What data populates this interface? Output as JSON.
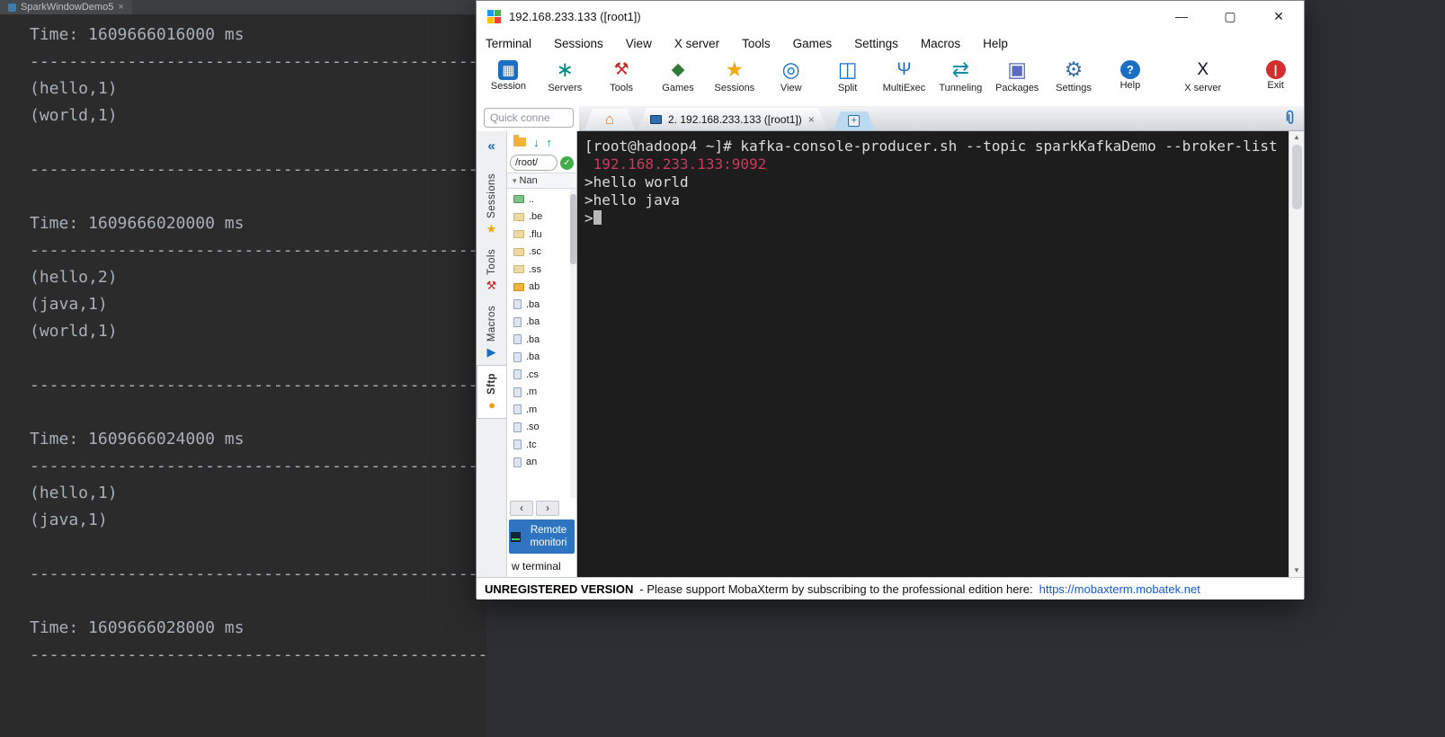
{
  "ide": {
    "tab": {
      "title": "SparkWindowDemo5",
      "close": "×"
    },
    "console_lines": [
      "Time: 1609666016000 ms",
      "-----------------------------------------------",
      "(hello,1)",
      "(world,1)",
      "",
      "-----------------------------------------------",
      "",
      "Time: 1609666020000 ms",
      "-----------------------------------------------",
      "(hello,2)",
      "(java,1)",
      "(world,1)",
      "",
      "-----------------------------------------------",
      "",
      "Time: 1609666024000 ms",
      "-----------------------------------------------",
      "(hello,1)",
      "(java,1)",
      "",
      "-----------------------------------------------",
      "",
      "Time: 1609666028000 ms",
      "-----------------------------------------------"
    ]
  },
  "moba": {
    "title": "192.168.233.133 ([root1])",
    "window_controls": {
      "minimize": "—",
      "maximize": "▢",
      "close": "✕"
    },
    "menu": [
      "Terminal",
      "Sessions",
      "View",
      "X server",
      "Tools",
      "Games",
      "Settings",
      "Macros",
      "Help"
    ],
    "toolbar": [
      {
        "label": "Session",
        "icon": "session-icon",
        "glyph": "▦",
        "color": "#ffffff",
        "bg": "#1a6fc4",
        "cls": "sq"
      },
      {
        "label": "Servers",
        "icon": "servers-icon",
        "glyph": "∗",
        "color": "#00897b",
        "cls": "big"
      },
      {
        "label": "Tools",
        "icon": "tools-icon",
        "glyph": "⚒",
        "color": "#c62828"
      },
      {
        "label": "Games",
        "icon": "games-icon",
        "glyph": "◆",
        "color": "#2e7d32"
      },
      {
        "label": "Sessions",
        "icon": "sessions-star-icon",
        "glyph": "★",
        "color": "#f0a911",
        "cls": "big"
      },
      {
        "label": "View",
        "icon": "view-icon",
        "glyph": "◎",
        "color": "#1a6fc4",
        "cls": "big"
      },
      {
        "label": "Split",
        "icon": "split-icon",
        "glyph": "◫",
        "color": "#1a6fc4",
        "cls": "big"
      },
      {
        "label": "MultiExec",
        "icon": "multiexec-icon",
        "glyph": "Ψ",
        "color": "#1a6fc4"
      },
      {
        "label": "Tunneling",
        "icon": "tunneling-icon",
        "glyph": "⇄",
        "color": "#0a8fa0",
        "cls": "big"
      },
      {
        "label": "Packages",
        "icon": "packages-icon",
        "glyph": "▣",
        "color": "#5c6bc0",
        "cls": "big"
      },
      {
        "label": "Settings",
        "icon": "settings-icon",
        "glyph": "⚙",
        "color": "#3b6ea5",
        "cls": "big"
      },
      {
        "label": "Help",
        "icon": "help-icon",
        "glyph": "?",
        "color": "#ffffff",
        "bg": "#1a6fc4",
        "cls": "round"
      },
      {
        "label": "X server",
        "icon": "xserver-icon",
        "glyph": "X",
        "color": "#101418",
        "cls": "xgap"
      },
      {
        "label": "Exit",
        "icon": "exit-icon",
        "glyph": "|",
        "color": "#ffffff",
        "bg": "#d32f2f",
        "cls": "round xgap"
      }
    ],
    "quick_connect": {
      "placeholder": "Quick conne"
    },
    "tabs": {
      "home_icon": "⌂",
      "active": {
        "label": "2. 192.168.233.133 ([root1])",
        "close": "×"
      },
      "new_tab": "+"
    },
    "sidebar": {
      "collapse": "«",
      "tabs": [
        {
          "label": "Sessions",
          "glyph": "★",
          "color": "#f0a911"
        },
        {
          "label": "Tools",
          "glyph": "⚒",
          "color": "#c62828"
        },
        {
          "label": "Macros",
          "glyph": "▶",
          "color": "#1a6fc4"
        },
        {
          "label": "Sftp",
          "glyph": "●",
          "color": "#f39c12",
          "cls": "selected"
        }
      ]
    },
    "sftp": {
      "path": "/root/",
      "column_header": "Nan",
      "files": [
        {
          "name": "..",
          "cls": "fo-up"
        },
        {
          "name": ".be",
          "cls": "fo"
        },
        {
          "name": ".flu",
          "cls": "fo"
        },
        {
          "name": ".sc",
          "cls": "fo"
        },
        {
          "name": ".ss",
          "cls": "fo"
        },
        {
          "name": "ab",
          "cls": "fo-b"
        },
        {
          "name": ".ba",
          "cls": "fi"
        },
        {
          "name": ".ba",
          "cls": "fi"
        },
        {
          "name": ".ba",
          "cls": "fi"
        },
        {
          "name": ".ba",
          "cls": "fi"
        },
        {
          "name": ".cs",
          "cls": "fi"
        },
        {
          "name": ".m",
          "cls": "fi"
        },
        {
          "name": ".m",
          "cls": "fi"
        },
        {
          "name": ".so",
          "cls": "fi"
        },
        {
          "name": ".tc",
          "cls": "fi"
        },
        {
          "name": "an",
          "cls": "fi"
        }
      ],
      "nav": {
        "back": "‹",
        "forward": "›"
      },
      "remote_monitoring": "Remote monitori",
      "new_terminal": "w terminal"
    },
    "terminal": {
      "lines": [
        {
          "text": "[root@hadoop4 ~]# kafka-console-producer.sh --topic sparkKafkaDemo --broker-list"
        },
        {
          "text": " 192.168.233.133:9092",
          "cls": "t-pink"
        },
        {
          "text": ">hello world"
        },
        {
          "text": ">hello java"
        }
      ],
      "prompt": ">"
    },
    "statusbar": {
      "version": "UNREGISTERED VERSION",
      "message": "-  Please support MobaXterm by subscribing to the professional edition here:",
      "link": "https://mobaxterm.mobatek.net"
    }
  }
}
